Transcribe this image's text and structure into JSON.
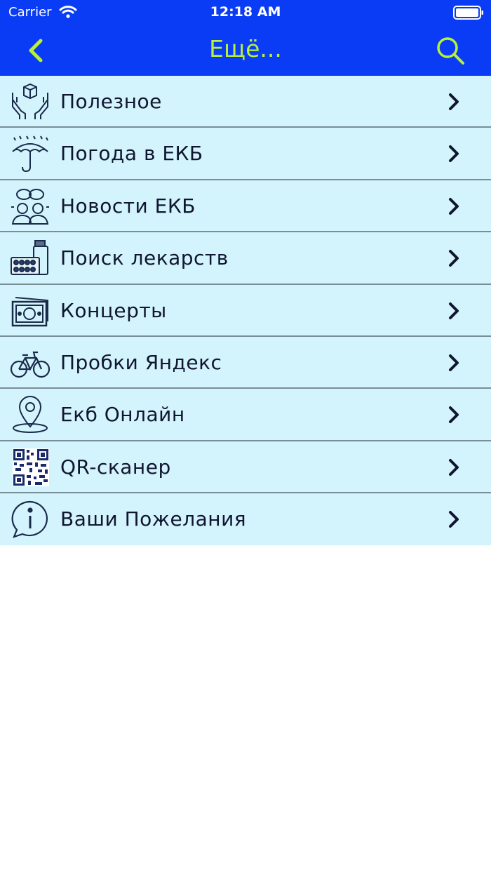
{
  "status_bar": {
    "carrier": "Carrier",
    "time": "12:18 AM"
  },
  "nav": {
    "title": "Ещё...",
    "accent_color": "#b8f03a",
    "background_color": "#0b3cf5"
  },
  "menu": {
    "items": [
      {
        "label": "Полезное",
        "icon": "hands-box-icon"
      },
      {
        "label": "Погода в ЕКБ",
        "icon": "umbrella-rain-icon"
      },
      {
        "label": "Новости ЕКБ",
        "icon": "people-chat-icon"
      },
      {
        "label": "Поиск лекарств",
        "icon": "pills-bottle-icon"
      },
      {
        "label": "Концерты",
        "icon": "banknotes-icon"
      },
      {
        "label": "Пробки Яндекс",
        "icon": "bicycle-icon"
      },
      {
        "label": "Екб Онлайн",
        "icon": "location-pin-icon"
      },
      {
        "label": "QR-сканер",
        "icon": "qr-code-icon"
      },
      {
        "label": "Ваши Пожелания",
        "icon": "info-bubble-icon"
      }
    ],
    "row_background": "#d3f4fc"
  }
}
